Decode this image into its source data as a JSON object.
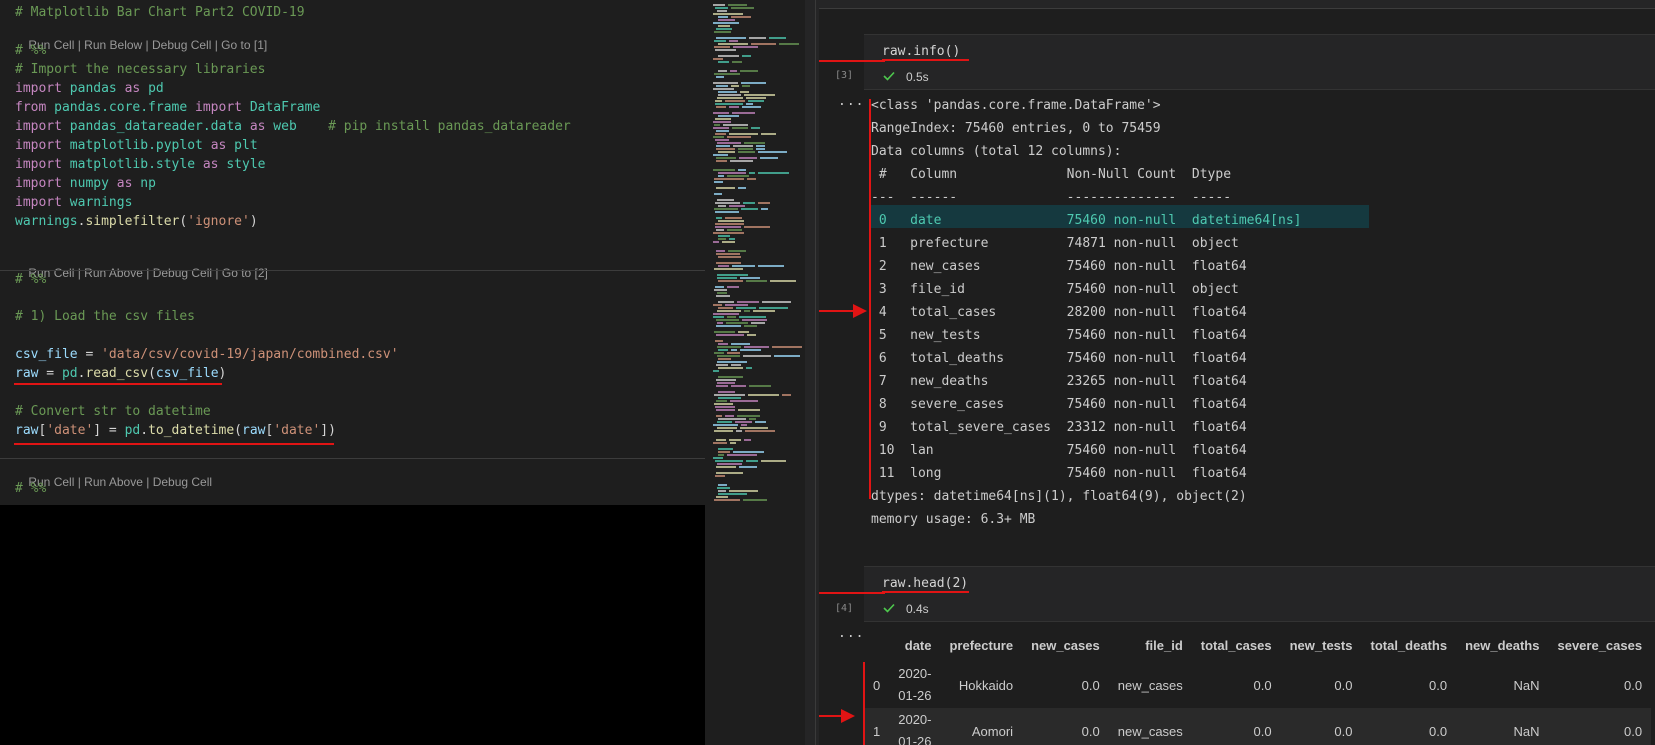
{
  "editor": {
    "lines": {
      "l1": "# Matplotlib Bar Chart Part2 COVID-19",
      "l2": "# %%",
      "l3": "# Import the necessary libraries",
      "l13": "# %%",
      "l14": "# 1) Load the csv files",
      "l15_var": "csv_file",
      "l15_eq": " = ",
      "l15_str": "'data/csv/covid-19/japan/combined.csv'",
      "l16_var": "raw",
      "l16_eq": " = ",
      "l16_mod": "pd",
      "l16_dot": ".",
      "l16_fn": "read_csv",
      "l16_open": "(",
      "l16_arg": "csv_file",
      "l16_close": ")",
      "l17": "# Convert str to datetime",
      "l18_a": "raw",
      "l18_b": "[",
      "l18_c": "'date'",
      "l18_d": "] = ",
      "l18_e": "pd",
      "l18_f": ".",
      "l18_g": "to_datetime",
      "l18_h": "(",
      "l18_i": "raw",
      "l18_j": "[",
      "l18_k": "'date'",
      "l18_l": "])",
      "l19": "# %%"
    },
    "imports": [
      {
        "kw1": "import",
        "mod": "pandas",
        "kw2": "as",
        "alias": "pd",
        "comment": ""
      },
      {
        "kw1": "from",
        "mod": "pandas.core.frame",
        "kw2": "import",
        "alias": "DataFrame",
        "comment": ""
      },
      {
        "kw1": "import",
        "mod": "pandas_datareader.data",
        "kw2": "as",
        "alias": "web",
        "comment": "# pip install pandas_datareader"
      },
      {
        "kw1": "import",
        "mod": "matplotlib.pyplot",
        "kw2": "as",
        "alias": "plt",
        "comment": ""
      },
      {
        "kw1": "import",
        "mod": "matplotlib.style",
        "kw2": "as",
        "alias": "style",
        "comment": ""
      },
      {
        "kw1": "import",
        "mod": "numpy",
        "kw2": "as",
        "alias": "np",
        "comment": ""
      },
      {
        "kw1": "import",
        "mod": "warnings",
        "kw2": "",
        "alias": "",
        "comment": ""
      }
    ],
    "simplefilter": {
      "obj": "warnings",
      "dot": ".",
      "fn": "simplefilter",
      "open": "(",
      "arg": "'ignore'",
      "close": ")"
    },
    "codelens": {
      "lens1": [
        "Run Cell",
        "Run Below",
        "Debug Cell",
        "Go to [1]"
      ],
      "lens2": [
        "Run Cell",
        "Run Above",
        "Debug Cell",
        "Go to [2]"
      ],
      "lens3": [
        "Run Cell",
        "Run Above",
        "Debug Cell"
      ],
      "sep": " | "
    }
  },
  "notebook": {
    "cell3": {
      "code": "raw.info()",
      "exec": "[3]",
      "time": "0.5s",
      "dots": "..."
    },
    "info_output": [
      "<class 'pandas.core.frame.DataFrame'>",
      "RangeIndex: 75460 entries, 0 to 75459",
      "Data columns (total 12 columns):",
      " #   Column              Non-Null Count  Dtype",
      "---  ------              --------------  -----",
      " 0   date                75460 non-null  datetime64[ns]",
      " 1   prefecture          74871 non-null  object",
      " 2   new_cases           75460 non-null  float64",
      " 3   file_id             75460 non-null  object",
      " 4   total_cases         28200 non-null  float64",
      " 5   new_tests           75460 non-null  float64",
      " 6   total_deaths        75460 non-null  float64",
      " 7   new_deaths          23265 non-null  float64",
      " 8   severe_cases        75460 non-null  float64",
      " 9   total_severe_cases  23312 non-null  float64",
      " 10  lan                 75460 non-null  float64",
      " 11  long                75460 non-null  float64",
      "dtypes: datetime64[ns](1), float64(9), object(2)",
      "memory usage: 6.3+ MB"
    ],
    "cell4": {
      "code": "raw.head(2)",
      "exec": "[4]",
      "time": "0.4s",
      "dots": "..."
    },
    "table": {
      "columns": [
        "",
        "date",
        "prefecture",
        "new_cases",
        "file_id",
        "total_cases",
        "new_tests",
        "total_deaths",
        "new_deaths",
        "severe_cases"
      ],
      "rows": [
        {
          "idx": "0",
          "date1": "2020-",
          "date2": "01-26",
          "prefecture": "Hokkaido",
          "new_cases": "0.0",
          "file_id": "new_cases",
          "total_cases": "0.0",
          "new_tests": "0.0",
          "total_deaths": "0.0",
          "new_deaths": "NaN",
          "severe_cases": "0.0"
        },
        {
          "idx": "1",
          "date1": "2020-",
          "date2": "01-26",
          "prefecture": "Aomori",
          "new_cases": "0.0",
          "file_id": "new_cases",
          "total_cases": "0.0",
          "new_tests": "0.0",
          "total_deaths": "0.0",
          "new_deaths": "NaN",
          "severe_cases": "0.0"
        }
      ]
    }
  },
  "colors": {
    "annotation": "#e11414",
    "check": "#4ec94e",
    "comment": "#6a9955",
    "keyword": "#c586c0"
  }
}
